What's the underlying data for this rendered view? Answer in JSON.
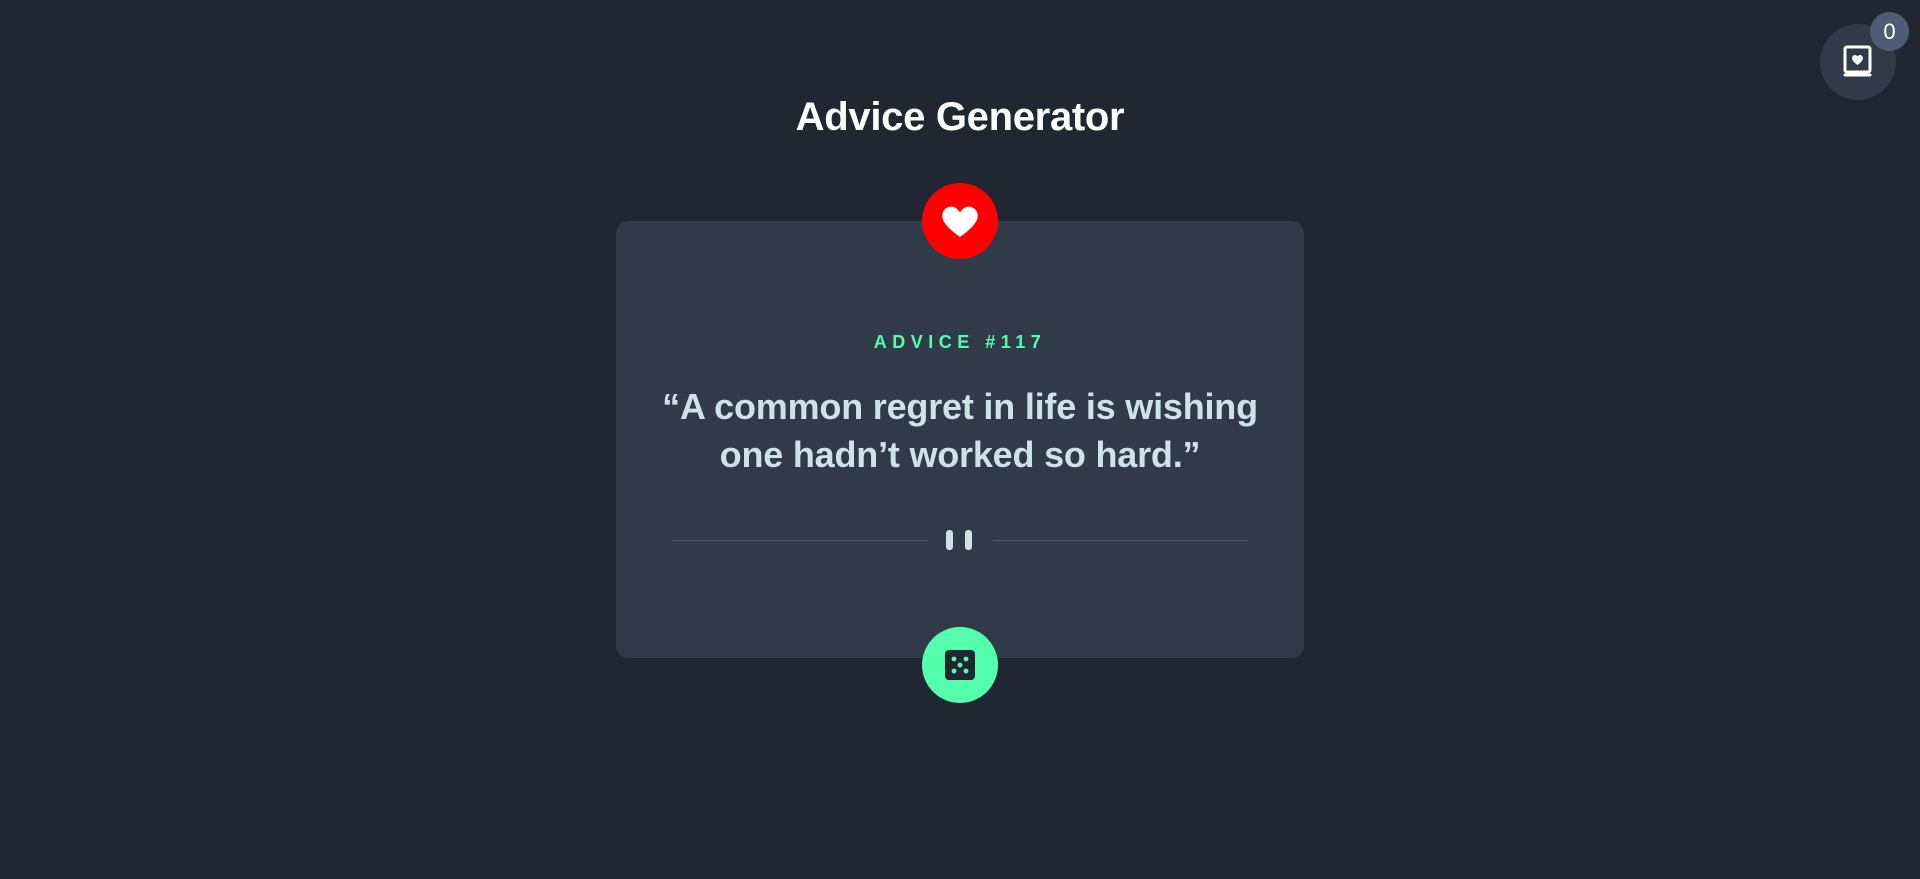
{
  "header": {
    "title": "Advice Generator"
  },
  "collection": {
    "icon": "book-heart-icon",
    "count": "0"
  },
  "card": {
    "favorite_icon": "heart-icon",
    "advice_label": "ADVICE #117",
    "quote": "“A common regret in life is wishing one hadn’t worked so hard.”",
    "divider_icon": "pause-icon",
    "dice_icon": "dice-icon"
  },
  "colors": {
    "background": "#202632",
    "card": "#313a49",
    "accent_green": "#53ffaa",
    "favorite_red": "#ff0000",
    "text_light": "#cee3e9",
    "divider": "#4f5d74"
  }
}
